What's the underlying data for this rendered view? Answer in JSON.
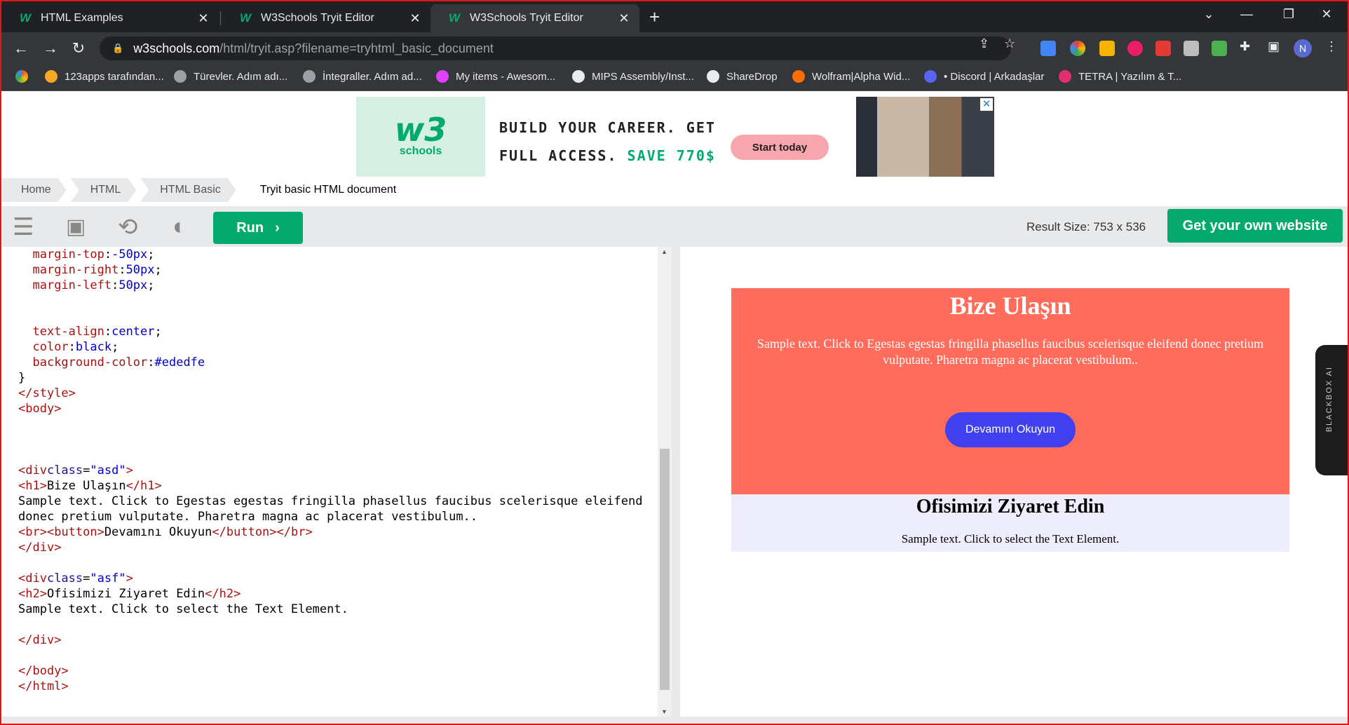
{
  "browser": {
    "tabs": [
      {
        "title": "HTML Examples",
        "active": false
      },
      {
        "title": "W3Schools Tryit Editor",
        "active": false
      },
      {
        "title": "W3Schools Tryit Editor",
        "active": true
      }
    ],
    "url_domain": "w3schools.com",
    "url_path": "/html/tryit.asp?filename=tryhtml_basic_document",
    "profile_initial": "N",
    "bookmarks": [
      {
        "label": "123apps tarafından...",
        "color": "#f9a825"
      },
      {
        "label": "Türevler. Adım adı...",
        "color": "#9aa0a6"
      },
      {
        "label": "İntegraller. Adım ad...",
        "color": "#9aa0a6"
      },
      {
        "label": "My items - Awesom...",
        "color": "#e040fb"
      },
      {
        "label": "MIPS Assembly/Inst...",
        "color": "#e8eaed"
      },
      {
        "label": "ShareDrop",
        "color": "#e8eaed"
      },
      {
        "label": "Wolfram|Alpha Wid...",
        "color": "#ff6d00"
      },
      {
        "label": "• Discord | Arkadaşlar",
        "color": "#5865f2"
      },
      {
        "label": "TETRA | Yazılım & T...",
        "color": "#e1306c"
      }
    ]
  },
  "ad": {
    "logo_mark": "w3",
    "logo_text": "schools",
    "line1": "BUILD YOUR CAREER. GET",
    "line2_prefix": "FULL ACCESS.",
    "line2_save": "SAVE 770$",
    "cta": "Start today",
    "close": "✕"
  },
  "breadcrumbs": [
    "Home",
    "HTML",
    "HTML Basic",
    "Tryit basic HTML document"
  ],
  "tryit": {
    "run_label": "Run",
    "result_size": "Result Size: 753 x 536",
    "get_website": "Get your own website"
  },
  "code_lines": [
    "  margin-top:-50px;",
    "  margin-right:50px;",
    "  margin-left:50px;",
    "",
    "",
    "  text-align:center;",
    "  color:black;",
    "  background-color:#ededfe",
    "}",
    "</style>",
    "<body>",
    "",
    "",
    "",
    "<div class=\"asd\">",
    "<h1>Bize Ulaşın</h1>",
    "Sample text. Click to Egestas egestas fringilla phasellus faucibus scelerisque eleifend",
    "donec pretium vulputate. Pharetra magna ac placerat vestibulum..",
    "<br><button>Devamını Okuyun</button></br>",
    "</div>",
    "",
    "<div class=\"asf\">",
    "<h2>Ofisimizi Ziyaret Edin</h2>",
    "Sample text. Click to select the Text Element.",
    "",
    "</div>",
    "",
    "</body>",
    "</html>"
  ],
  "result": {
    "h1": "Bize Ulaşın",
    "p1": "Sample text. Click to Egestas egestas fringilla phasellus faucibus scelerisque eleifend donec pretium vulputate. Pharetra magna ac placerat vestibulum..",
    "button": "Devamını Okuyun",
    "h2": "Ofisimizi Ziyaret Edin",
    "p2": "Sample text. Click to select the Text Element."
  },
  "side_widget": "BLACKBOX AI",
  "colors": {
    "accent": "#04aa6d",
    "asd_bg": "#ff6c5c",
    "asf_bg": "#ededfe",
    "button": "#4040ee"
  }
}
